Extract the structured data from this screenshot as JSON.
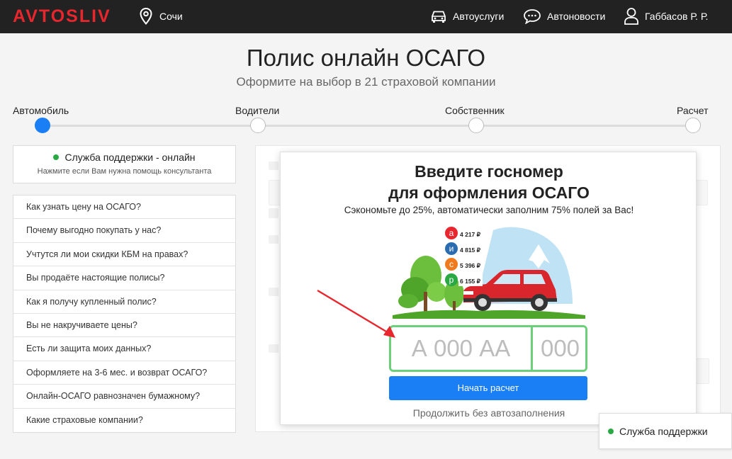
{
  "header": {
    "logo": "AVTOSLIV",
    "city": "Сочи",
    "nav": [
      "Автоуслуги",
      "Автоновости",
      "Габбасов Р. Р."
    ]
  },
  "page": {
    "title": "Полис онлайн ОСАГО",
    "subtitle": "Оформите на выбор в 21 страховой компании"
  },
  "steps": {
    "labels": [
      "Автомобиль",
      "Водители",
      "Собственник",
      "Расчет"
    ],
    "active_index": 0
  },
  "support": {
    "status": "Служба поддержки - онлайн",
    "hint": "Нажмите если Вам нужна помощь консультанта"
  },
  "faq": [
    "Как узнать цену на ОСАГО?",
    "Почему выгодно покупать у нас?",
    "Учтутся ли мои скидки КБМ на правах?",
    "Вы продаёте настоящие полисы?",
    "Как я получу купленный полис?",
    "Вы не накручиваете цены?",
    "Есть ли защита моих данных?",
    "Оформляете на 3-6 мес. и возврат ОСАГО?",
    "Онлайн-ОСАГО равнозначен бумажному?",
    "Какие страховые компании?"
  ],
  "modal": {
    "title_line1": "Введите госномер",
    "title_line2": "для оформления ОСАГО",
    "subtitle": "Сэкономьте до 25%, автоматически заполним 75% полей за Вас!",
    "offers": [
      {
        "letter": "а",
        "price": "4 217 ₽",
        "color": "#e8262e"
      },
      {
        "letter": "и",
        "price": "4 815 ₽",
        "color": "#2b6cb0"
      },
      {
        "letter": "с",
        "price": "5 396 ₽",
        "color": "#f07a1e"
      },
      {
        "letter": "р",
        "price": "6 155 ₽",
        "color": "#2aa844"
      }
    ],
    "plate_placeholder": "А 000 АА",
    "region_placeholder": "000",
    "start_button": "Начать расчет",
    "skip_link": "Продолжить без автозаполнения"
  },
  "support_float": "Служба поддержки",
  "colors": {
    "brand_red": "#e8262e",
    "primary_blue": "#1a7ff5",
    "plate_green": "#6cd07b",
    "online_green": "#2aa844"
  }
}
